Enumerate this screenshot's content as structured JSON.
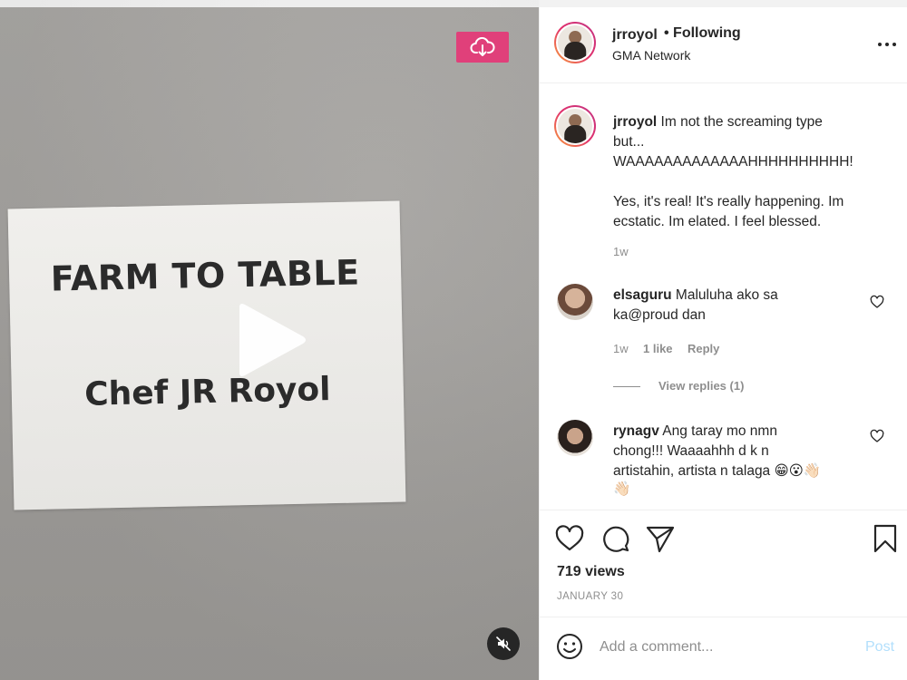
{
  "media": {
    "sign_line1": "FARM TO TABLE",
    "sign_line2": "Chef JR Royol"
  },
  "header": {
    "username": "jrroyol",
    "following_label": "• Following",
    "subtitle": "GMA Network"
  },
  "caption": {
    "username": "jrroyol",
    "line1": "Im not the screaming type",
    "line2": "but...",
    "line3": "WAAAAAAAAAAAAAHHHHHHHHHH!",
    "line4": "Yes, it's real! It's really happening. Im",
    "line5": "ecstatic. Im elated. I feel blessed.",
    "time": "1w"
  },
  "comments": [
    {
      "username": "elsaguru",
      "line1": "Maluluha ako sa",
      "line2": "ka@proud dan",
      "time": "1w",
      "likes": "1 like",
      "reply": "Reply",
      "view_replies": "View replies (1)"
    },
    {
      "username": "rynagv",
      "line1": "Ang taray mo nmn",
      "line2": "chong!!! Waaaahhh d k n",
      "line3": "artistahin, artista n talaga 😁😮👋🏻",
      "line4": "👋🏻"
    }
  ],
  "stats": {
    "views": "719 views",
    "date": "JANUARY 30"
  },
  "comment_box": {
    "placeholder": "Add a comment...",
    "post_label": "Post"
  },
  "icons": {
    "download": "cloud-download-icon",
    "play": "play-icon",
    "mute": "muted-speaker-icon",
    "more": "more-horizontal-icon",
    "like": "heart-icon",
    "comment": "comment-bubble-icon",
    "share": "paper-plane-icon",
    "save": "bookmark-icon",
    "emoji": "smiley-icon"
  },
  "colors": {
    "download_button": "#e0407a",
    "post_button": "#b2dffc",
    "meta_text": "#8e8e8e"
  }
}
